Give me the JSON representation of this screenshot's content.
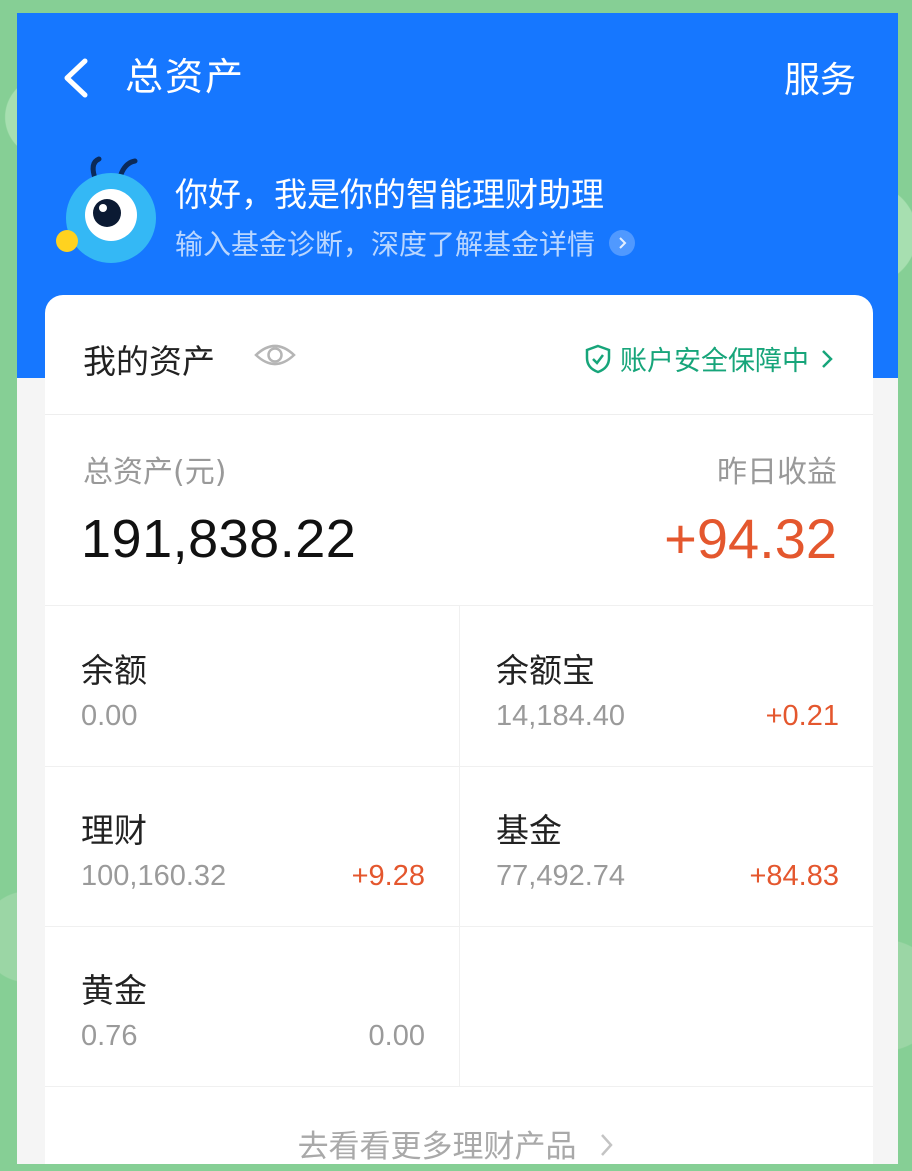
{
  "header": {
    "title": "总资产",
    "service_label": "服务",
    "back_icon": "chevron-left-icon",
    "bg_color": "#1677ff"
  },
  "assistant": {
    "title": "你好，我是你的智能理财助理",
    "subtitle": "输入基金诊断，深度了解基金详情"
  },
  "assets": {
    "heading": "我的资产",
    "security_text": "账户安全保障中",
    "total_label": "总资产(元)",
    "total_value": "191,838.22",
    "yesterday_label": "昨日收益",
    "yesterday_value": "+94.32",
    "positive_color": "#e4572e",
    "security_color": "#17a57a",
    "items": [
      {
        "name": "余额",
        "amount": "0.00",
        "change": ""
      },
      {
        "name": "余额宝",
        "amount": "14,184.40",
        "change": "+0.21"
      },
      {
        "name": "理财",
        "amount": "100,160.32",
        "change": "+9.28"
      },
      {
        "name": "基金",
        "amount": "77,492.74",
        "change": "+84.83"
      },
      {
        "name": "黄金",
        "amount": "0.76",
        "change": "0.00"
      }
    ],
    "more_link": "去看看更多理财产品"
  }
}
